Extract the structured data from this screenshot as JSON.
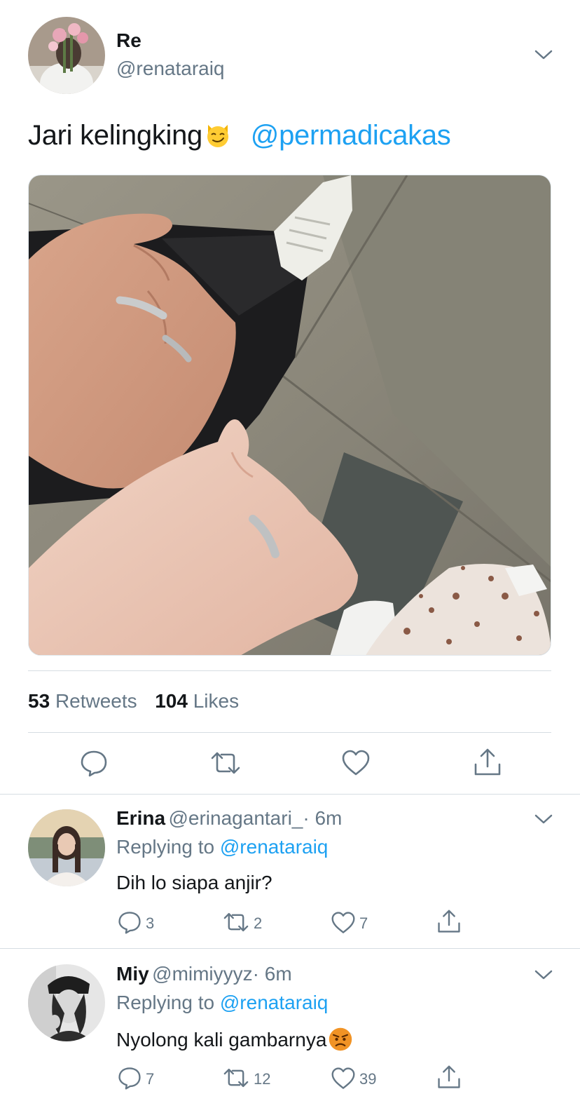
{
  "tweet": {
    "author_name": "Re",
    "author_handle": "@renataraiq",
    "text": "Jari kelingking",
    "emoji": "smirking-cat-face",
    "mention": "@permadicakas",
    "retweets_count": "53",
    "retweets_label": "Retweets",
    "likes_count": "104",
    "likes_label": "Likes"
  },
  "actions": [
    "reply-icon",
    "retweet-icon",
    "like-icon",
    "share-icon"
  ],
  "replies": [
    {
      "name": "Erina",
      "handle": "@erinagantari_",
      "time": "· 6m",
      "replying_prefix": "Replying to",
      "replying_to": "@renataraiq",
      "text": "Dih lo siapa anjir?",
      "reply_count": "3",
      "retweet_count": "2",
      "like_count": "7"
    },
    {
      "name": "Miy",
      "handle": "@mimiyyyz",
      "time": "· 6m",
      "replying_prefix": "Replying to",
      "replying_to": "@renataraiq",
      "text": "Nyolong kali gambarnya",
      "emoji": "pouting-face",
      "reply_count": "7",
      "retweet_count": "12",
      "like_count": "39"
    }
  ],
  "colors": {
    "link": "#1da1f2",
    "muted": "#657786",
    "text": "#14171a",
    "divider": "#d6dde3"
  }
}
